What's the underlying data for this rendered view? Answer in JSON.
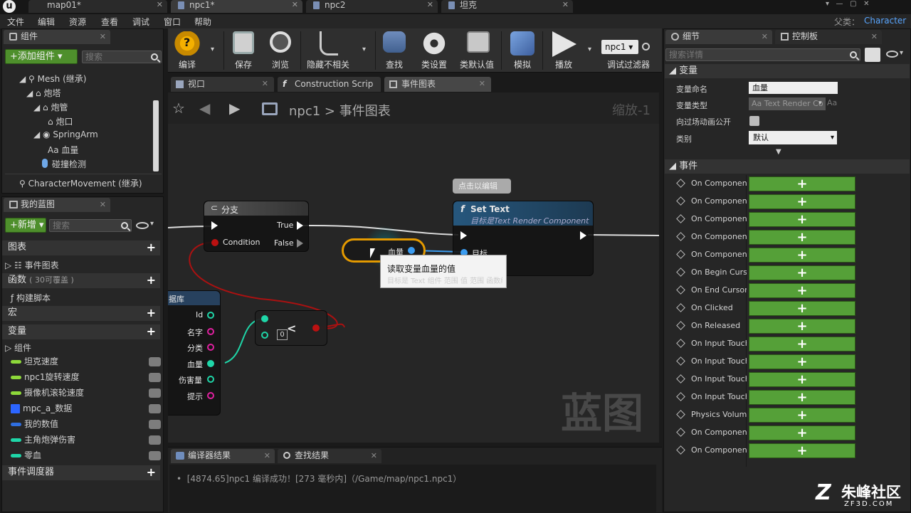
{
  "doc_tabs": [
    "map01*",
    "npc1*",
    "npc2",
    "坦克"
  ],
  "parent_label": "父类：",
  "parent_value": "Character",
  "menu": [
    "文件",
    "编辑",
    "资源",
    "查看",
    "调试",
    "窗口",
    "帮助"
  ],
  "components": {
    "tab": "组件",
    "add_button": "+添加组件",
    "search_placeholder": "搜索",
    "tree": [
      "Mesh (继承)",
      "炮塔",
      "炮管",
      "炮口",
      "SpringArm",
      "血量",
      "碰撞检测",
      "CharacterMovement (继承)"
    ]
  },
  "my_blueprint": {
    "tab": "我的蓝图",
    "new_button": "+新增",
    "search_placeholder": "搜索",
    "graphs_header": "图表",
    "event_graph": "事件图表",
    "functions_header": "函数",
    "functions_hint": "( 30可覆盖 )",
    "construction_script": "构建脚本",
    "macros_header": "宏",
    "variables_header": "变量",
    "components_group": "组件",
    "variables": [
      {
        "name": "坦克速度",
        "color": "#8ed93a"
      },
      {
        "name": "npc1旋转速度",
        "color": "#8ed93a"
      },
      {
        "name": "摄像机滚轮速度",
        "color": "#8ed93a"
      },
      {
        "name": "mpc_a_数据",
        "color": "#2c65ff"
      },
      {
        "name": "我的数值",
        "color": "#2f6ee0"
      },
      {
        "name": "主角炮弹伤害",
        "color": "#1fd6a8"
      },
      {
        "name": "零血",
        "color": "#1fd6a8"
      }
    ],
    "dispatchers_header": "事件调度器"
  },
  "toolbar": {
    "compile": "编译",
    "save": "保存",
    "browse": "浏览",
    "hide_unrelated": "隐藏不相关",
    "find": "查找",
    "class_settings": "类设置",
    "class_defaults": "类默认值",
    "simulate": "模拟",
    "play": "播放",
    "debug_filter": "调试过滤器",
    "debug_object": "npc1"
  },
  "graph_tabs": [
    "视口",
    "Construction Scrip",
    "事件图表"
  ],
  "breadcrumb": {
    "root": "npc1",
    "sep": ">",
    "current": "事件图表"
  },
  "zoom": "缩放-1",
  "watermark": "蓝图",
  "nodes": {
    "branch": {
      "title": "分支",
      "true": "True",
      "condition": "Condition",
      "false": "False"
    },
    "settext": {
      "title": "Set Text",
      "subtitle": "目标是Text Render Component",
      "target": "目标"
    },
    "comment_bubble": "点击以编辑",
    "var_get": "血量",
    "tooltip": "读取变量血量的值",
    "tooltip_ghost": "目标是 Text 组件 范围 值 范围 函数编辑",
    "struct": {
      "title": "据库",
      "pins": [
        "Id",
        "名字",
        "分类",
        "血量",
        "伤害量",
        "提示"
      ]
    },
    "compare": {
      "symbol": "<",
      "value": "0"
    }
  },
  "bottom_tabs": [
    "编译器结果",
    "查找结果"
  ],
  "log_line": "[4874.65]npc1 编译成功！[273 毫秒内]（/Game/map/npc1.npc1）",
  "details": {
    "tab": "细节",
    "tab2": "控制板",
    "search_placeholder": "搜索详情",
    "variables_header": "变量",
    "var_name_label": "变量命名",
    "var_name_value": "血量",
    "var_type_label": "变量类型",
    "var_type_value": "Text Render Co",
    "expose_label": "向过场动画公开",
    "category_label": "类别",
    "category_value": "默认",
    "events_header": "事件",
    "events": [
      "On Component",
      "On Component",
      "On Component",
      "On Component",
      "On Component",
      "On Begin Cursor",
      "On End Cursor",
      "On Clicked",
      "On Released",
      "On Input Touch",
      "On Input Touch",
      "On Input Touch",
      "On Input Touch",
      "Physics Volume",
      "On Component",
      "On Component"
    ],
    "add_symbol": "+"
  },
  "brand": {
    "name": "朱峰社区",
    "url": "ZF3D.COM"
  }
}
